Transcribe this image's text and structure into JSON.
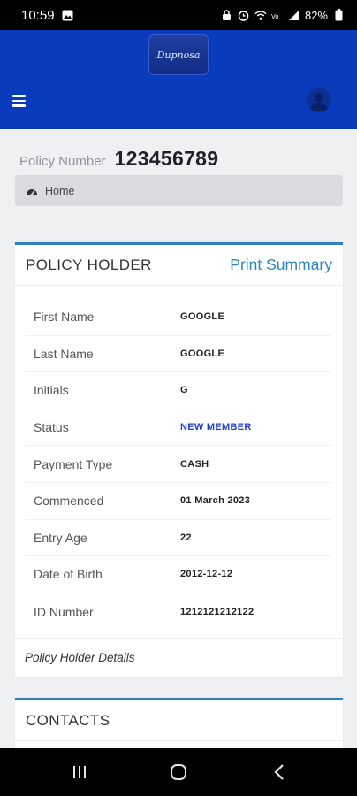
{
  "status_bar": {
    "time": "10:59",
    "battery": "82%",
    "icons_left": [
      "image-icon"
    ],
    "icons_right": [
      "lock-icon",
      "alarm-icon",
      "wifi-icon",
      "volte-icon",
      "signal-icon",
      "battery-icon"
    ]
  },
  "header": {
    "logo_text": "Dupnosa",
    "colors": {
      "header_bg": "#0a3bbd",
      "accent": "#2f7fbf",
      "status": "#2541c9"
    }
  },
  "policy": {
    "label": "Policy Number",
    "number": "123456789"
  },
  "breadcrumb": {
    "home": "Home"
  },
  "policy_holder": {
    "title": "POLICY HOLDER",
    "print_label": "Print Summary",
    "rows": [
      {
        "label": "First Name",
        "value": "GOOGLE"
      },
      {
        "label": "Last Name",
        "value": "GOOGLE"
      },
      {
        "label": "Initials",
        "value": "G"
      },
      {
        "label": "Status",
        "value": "NEW MEMBER"
      },
      {
        "label": "Payment Type",
        "value": "CASH"
      },
      {
        "label": "Commenced",
        "value": "01 March 2023"
      },
      {
        "label": "Entry Age",
        "value": "22"
      },
      {
        "label": "Date of Birth",
        "value": "2012-12-12"
      },
      {
        "label": "ID Number",
        "value": "1212121212122"
      }
    ],
    "footer": "Policy Holder Details"
  },
  "contacts": {
    "title": "CONTACTS"
  },
  "nav": {
    "buttons": [
      "recents-icon",
      "home-icon",
      "back-icon"
    ]
  }
}
